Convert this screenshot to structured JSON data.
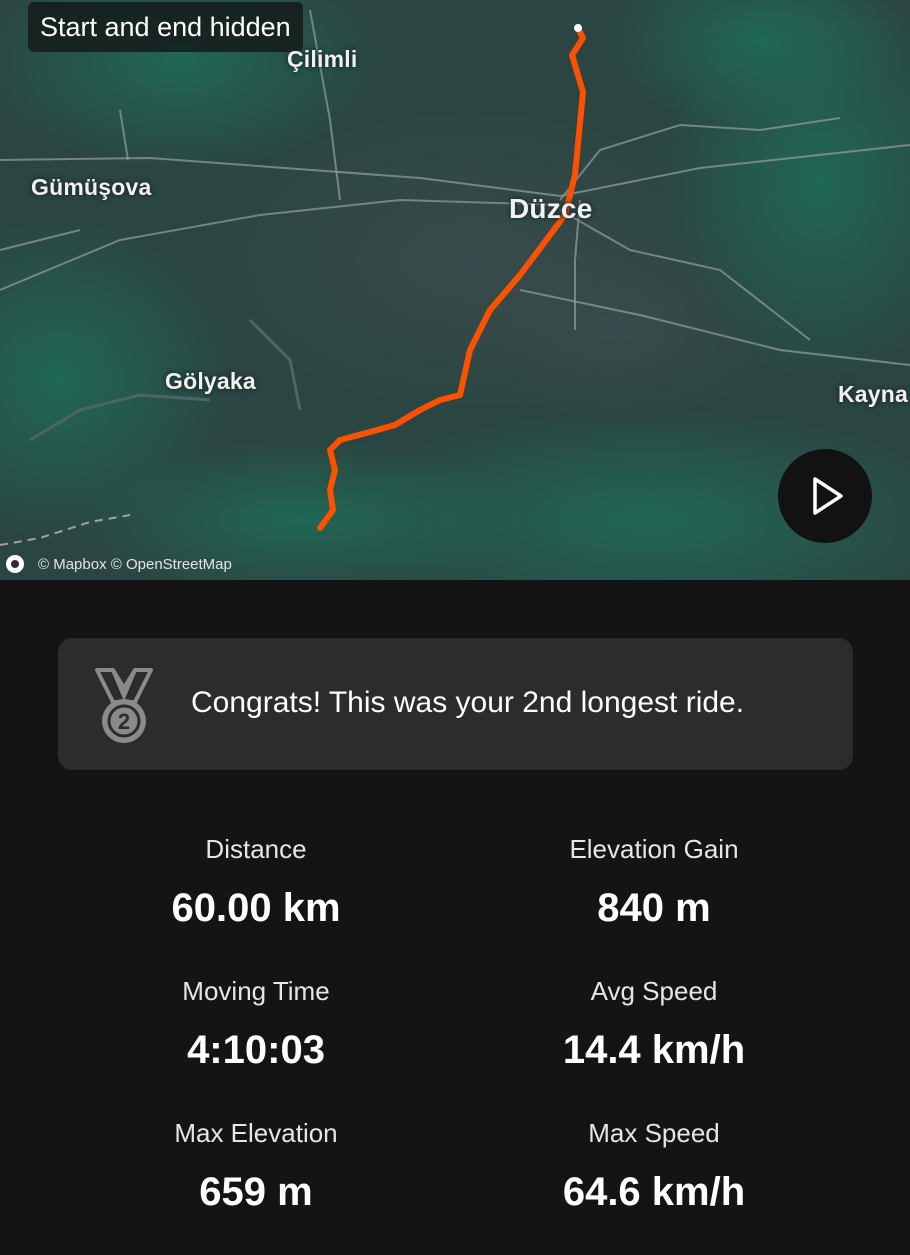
{
  "map": {
    "badge": "Start and end hidden",
    "places": {
      "cilimli": "Çilimli",
      "gumusova": "Gümüşova",
      "duzce": "Düzce",
      "golyaka": "Gölyaka",
      "kaynasli": "Kayna"
    },
    "attribution": "© Mapbox © OpenStreetMap",
    "route_color": "#fc5200",
    "play_icon": "play-icon"
  },
  "achievement": {
    "icon": "medal-icon",
    "rank": "2",
    "text": "Congrats! This was your 2nd longest ride."
  },
  "stats": [
    {
      "label": "Distance",
      "value": "60.00 km"
    },
    {
      "label": "Elevation Gain",
      "value": "840 m"
    },
    {
      "label": "Moving Time",
      "value": "4:10:03"
    },
    {
      "label": "Avg Speed",
      "value": "14.4 km/h"
    },
    {
      "label": "Max Elevation",
      "value": "659 m"
    },
    {
      "label": "Max Speed",
      "value": "64.6 km/h"
    }
  ],
  "colors": {
    "background": "#141414",
    "card": "#2c2c2c",
    "map_base": "#2a4541"
  }
}
